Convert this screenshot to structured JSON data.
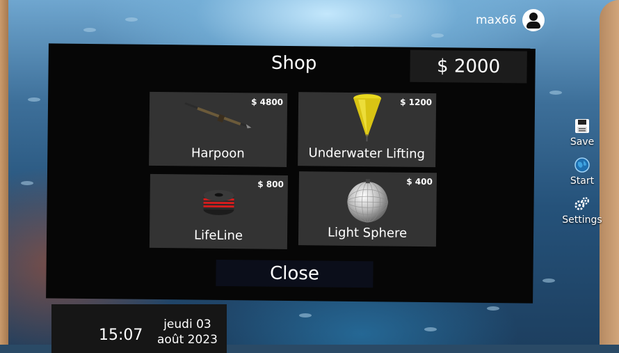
{
  "user": {
    "name": "max66"
  },
  "side_menu": [
    {
      "label": "Save",
      "icon": "floppy-icon"
    },
    {
      "label": "Start",
      "icon": "globe-icon"
    },
    {
      "label": "Settings",
      "icon": "gears-icon"
    }
  ],
  "shop": {
    "title": "Shop",
    "money": "$ 2000",
    "items": [
      {
        "name": "Harpoon",
        "price": "$ 4800",
        "icon": "harpoon-icon"
      },
      {
        "name": "Underwater Lifting",
        "price": "$ 1200",
        "icon": "lift-buoy-icon"
      },
      {
        "name": "LifeLine",
        "price": "$ 800",
        "icon": "rope-spool-icon"
      },
      {
        "name": "Light Sphere",
        "price": "$ 400",
        "icon": "mirror-ball-icon"
      }
    ],
    "close_label": "Close"
  },
  "clock": {
    "time": "15:07",
    "day": "jeudi 03",
    "month_year": "août  2023"
  }
}
